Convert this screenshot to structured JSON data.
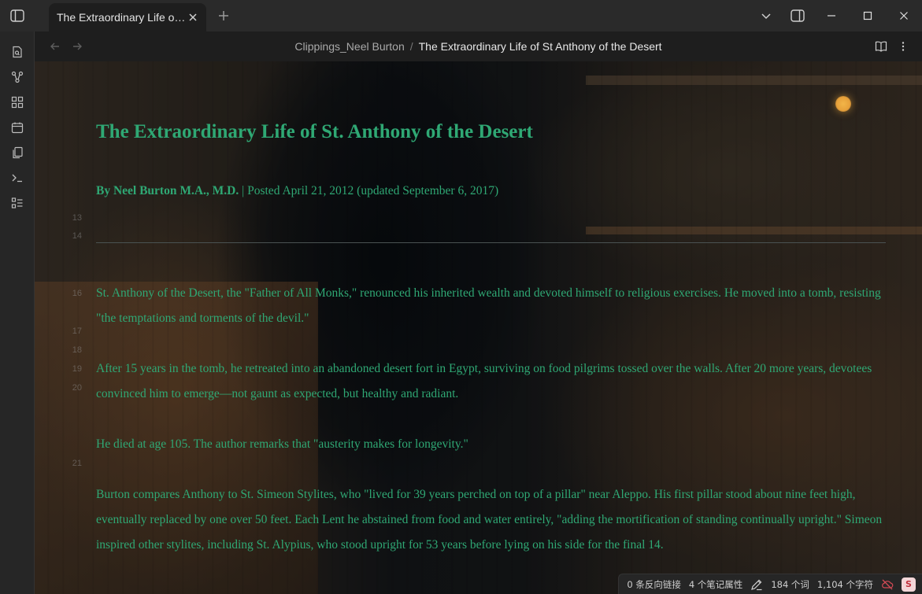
{
  "tab": {
    "title": "The Extraordinary Life of St Anthony of the Desert",
    "title_display": "The Extraordinary Life of..."
  },
  "breadcrumb": {
    "parent": "Clippings_Neel Burton",
    "separator": "/",
    "current": "The Extraordinary Life of St Anthony of the Desert"
  },
  "document": {
    "title": "The Extraordinary Life of St. Anthony of the Desert",
    "byline_author": "By Neel Burton M.A., M.D.",
    "byline_rest": " | Posted April 21, 2012 (updated September 6, 2017)",
    "paragraphs": [
      "St. Anthony of the Desert, the \"Father of All Monks,\" renounced his inherited wealth and devoted himself to religious exercises. He moved into a tomb, resisting \"the temptations and torments of the devil.\"",
      "After 15 years in the tomb, he retreated into an abandoned desert fort in Egypt, surviving on food pilgrims tossed over the walls. After 20 more years, devotees convinced him to emerge—not gaunt as expected, but healthy and radiant.",
      "He died at age 105. The author remarks that \"austerity makes for longevity.\"",
      "Burton compares Anthony to St. Simeon Stylites, who \"lived for 39 years perched on top of a pillar\" near Aleppo. His first pillar stood about nine feet high, eventually replaced by one over 50 feet. Each Lent he abstained from food and water entirely, \"adding the mortification of standing continually upright.\" Simeon inspired other stylites, including St. Alypius, who stood upright for 53 years before lying on his side for the final 14."
    ],
    "line_numbers": {
      "n13": "13",
      "n14": "14",
      "n16": "16",
      "n17": "17",
      "n18": "18",
      "n19": "19",
      "n20": "20",
      "n21": "21"
    }
  },
  "status": {
    "backlinks": "0 条反向链接",
    "properties": "4 个笔记属性",
    "words": "184 个词",
    "chars": "1,104 个字符",
    "sync_label": "S"
  },
  "colors": {
    "accent_text": "#2fa874",
    "sync_badge": "#c0303c"
  }
}
